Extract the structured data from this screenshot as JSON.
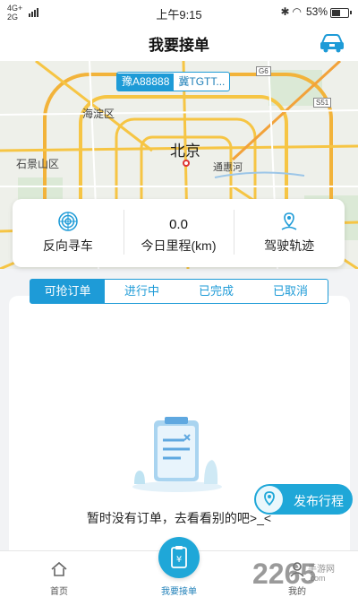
{
  "status_bar": {
    "network_top": "4G+",
    "network_bottom": "2G",
    "time": "上午9:15",
    "battery": "53%",
    "battery_level": 0.53
  },
  "header": {
    "title": "我要接单",
    "car_icon": "car-icon"
  },
  "map": {
    "plates": [
      "豫A88888",
      "冀TGTT..."
    ],
    "labels": {
      "haidian": "海淀区",
      "shijingshan": "石景山区",
      "beijing": "北京",
      "tonghuihe": "通惠河",
      "s51": "S51",
      "g6": "G6"
    }
  },
  "stats": {
    "reverse_search_label": "反向寻车",
    "mileage_value": "0.0",
    "mileage_label": "今日里程(km)",
    "track_label": "驾驶轨迹"
  },
  "tabs": [
    "可抢订单",
    "进行中",
    "已完成",
    "已取消"
  ],
  "empty": {
    "text": "暂时没有订单，去看看别的吧>_<"
  },
  "publish": {
    "label": "发布行程"
  },
  "nav": {
    "home": "首页",
    "accept": "我要接单",
    "mine": "我的"
  },
  "watermark": {
    "number": "2265",
    "cn": "手游网",
    "url": ".com"
  },
  "colors": {
    "accent": "#1e9bd7",
    "accent_light": "#1fa7d8"
  }
}
